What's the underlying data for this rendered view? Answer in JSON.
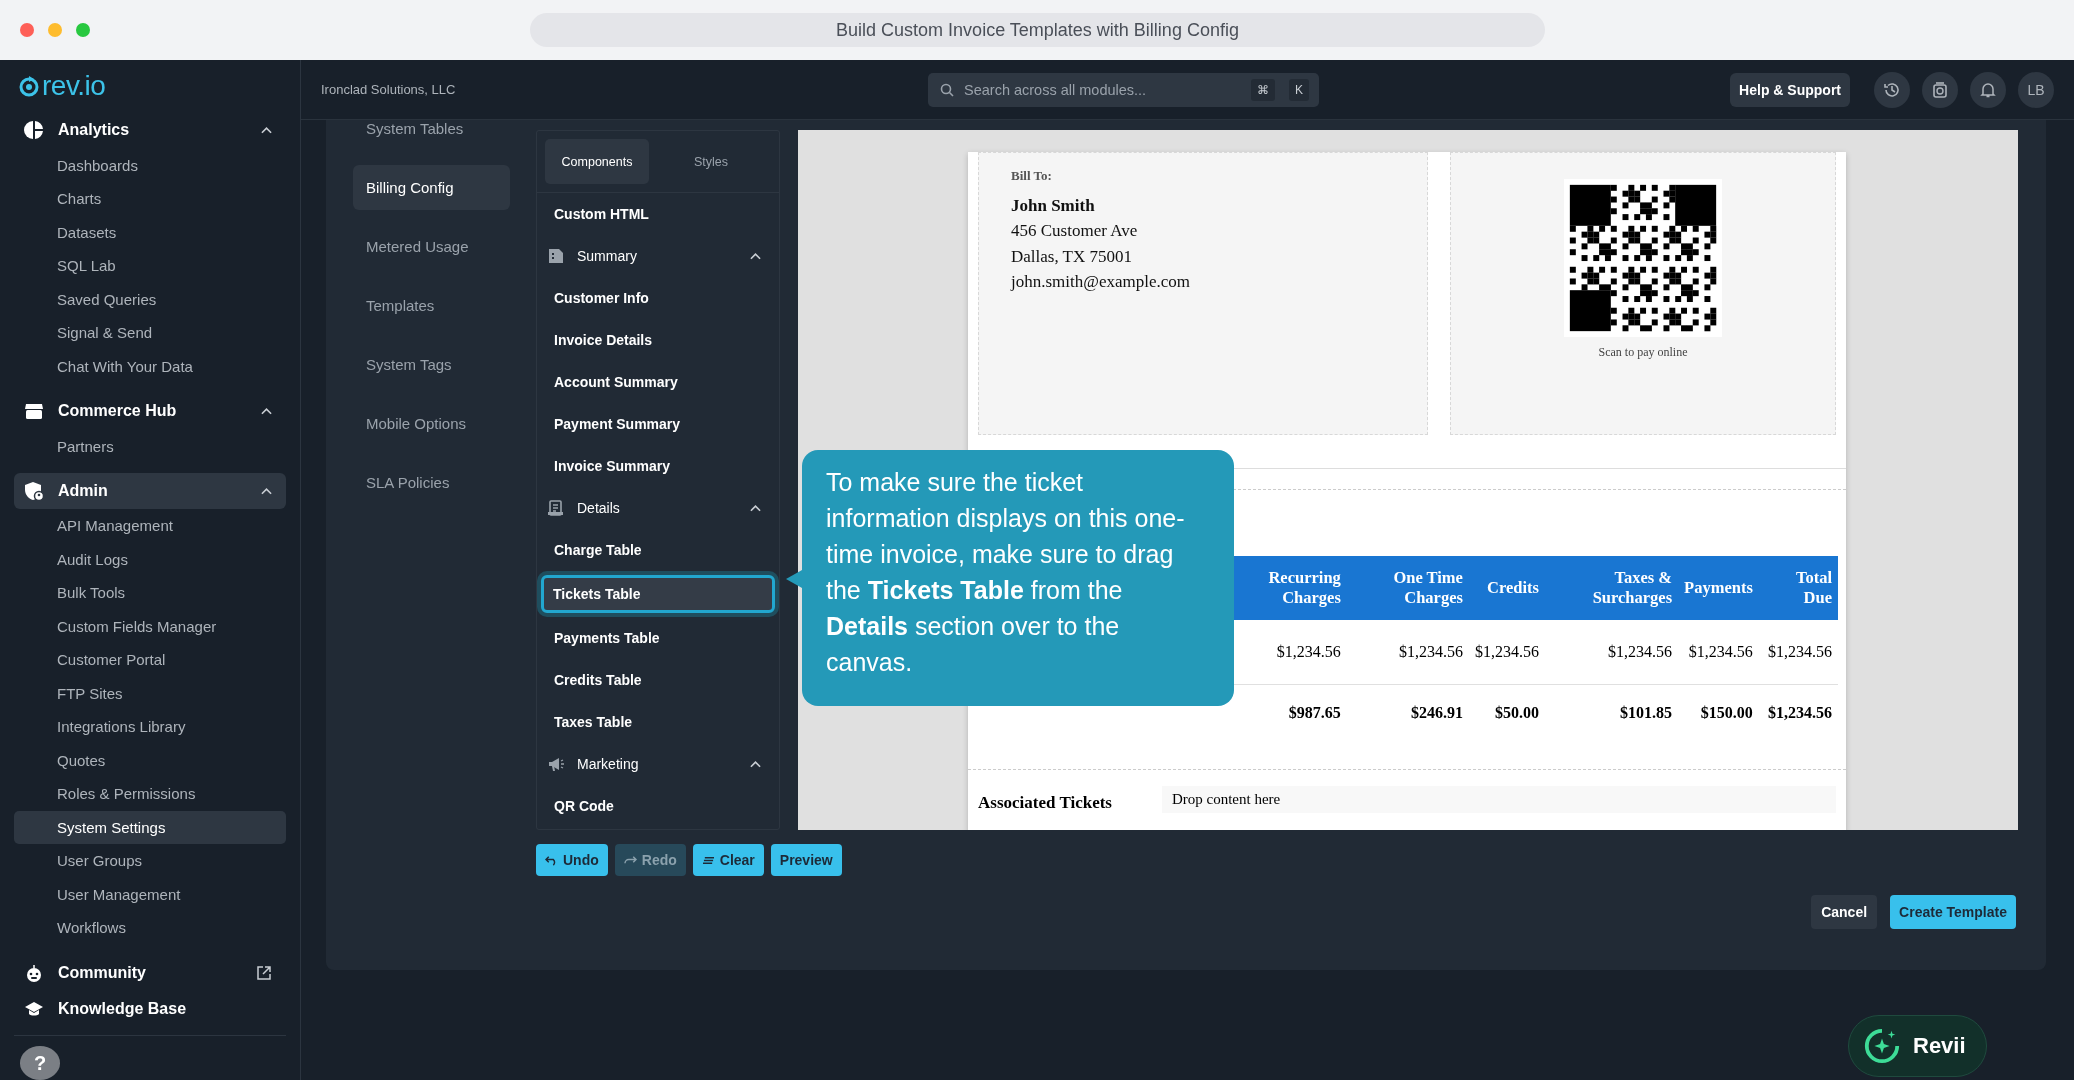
{
  "window": {
    "title": "Build Custom Invoice Templates with Billing Config"
  },
  "sidebar": {
    "logo": "rev.io",
    "groups": [
      {
        "label": "Analytics",
        "expanded": true,
        "selected": false,
        "items": [
          {
            "label": "Dashboards",
            "selected": false
          },
          {
            "label": "Charts",
            "selected": false
          },
          {
            "label": "Datasets",
            "selected": false
          },
          {
            "label": "SQL Lab",
            "selected": false
          },
          {
            "label": "Saved Queries",
            "selected": false
          },
          {
            "label": "Signal & Send",
            "selected": false
          },
          {
            "label": "Chat With Your Data",
            "selected": false
          }
        ]
      },
      {
        "label": "Commerce Hub",
        "expanded": true,
        "selected": false,
        "items": [
          {
            "label": "Partners",
            "selected": false
          }
        ]
      },
      {
        "label": "Admin",
        "expanded": true,
        "selected": true,
        "items": [
          {
            "label": "API Management",
            "selected": false
          },
          {
            "label": "Audit Logs",
            "selected": false
          },
          {
            "label": "Bulk Tools",
            "selected": false
          },
          {
            "label": "Custom Fields Manager",
            "selected": false
          },
          {
            "label": "Customer Portal",
            "selected": false
          },
          {
            "label": "FTP Sites",
            "selected": false
          },
          {
            "label": "Integrations Library",
            "selected": false
          },
          {
            "label": "Quotes",
            "selected": false
          },
          {
            "label": "Roles & Permissions",
            "selected": false
          },
          {
            "label": "System Settings",
            "selected": true
          },
          {
            "label": "User Groups",
            "selected": false
          },
          {
            "label": "User Management",
            "selected": false
          },
          {
            "label": "Workflows",
            "selected": false
          }
        ]
      }
    ],
    "links": [
      {
        "label": "Community",
        "external": true
      },
      {
        "label": "Knowledge Base",
        "external": false
      }
    ],
    "help": "?"
  },
  "header": {
    "company": "Ironclad Solutions, LLC",
    "search": {
      "placeholder": "Search across all modules...",
      "keys": [
        "⌘",
        "K"
      ]
    },
    "help_button": "Help & Support",
    "avatar": "LB"
  },
  "settings_nav": [
    {
      "label": "System Tables",
      "selected": false
    },
    {
      "label": "Billing Config",
      "selected": true
    },
    {
      "label": "Metered Usage",
      "selected": false
    },
    {
      "label": "Templates",
      "selected": false
    },
    {
      "label": "System Tags",
      "selected": false
    },
    {
      "label": "Mobile Options",
      "selected": false
    },
    {
      "label": "SLA Policies",
      "selected": false
    }
  ],
  "components_panel": {
    "tabs": [
      {
        "label": "Components",
        "selected": true
      },
      {
        "label": "Styles",
        "selected": false
      }
    ],
    "items": [
      {
        "kind": "item",
        "label": "Custom HTML",
        "selected": false
      },
      {
        "kind": "section",
        "label": "Summary",
        "expanded": true
      },
      {
        "kind": "item",
        "label": "Customer Info",
        "selected": false
      },
      {
        "kind": "item",
        "label": "Invoice Details",
        "selected": false
      },
      {
        "kind": "item",
        "label": "Account Summary",
        "selected": false
      },
      {
        "kind": "item",
        "label": "Payment Summary",
        "selected": false
      },
      {
        "kind": "item",
        "label": "Invoice Summary",
        "selected": false
      },
      {
        "kind": "section",
        "label": "Details",
        "expanded": true
      },
      {
        "kind": "item",
        "label": "Charge Table",
        "selected": false
      },
      {
        "kind": "item",
        "label": "Tickets Table",
        "selected": true
      },
      {
        "kind": "item",
        "label": "Payments Table",
        "selected": false
      },
      {
        "kind": "item",
        "label": "Credits Table",
        "selected": false
      },
      {
        "kind": "item",
        "label": "Taxes Table",
        "selected": false
      },
      {
        "kind": "section",
        "label": "Marketing",
        "expanded": true
      },
      {
        "kind": "item",
        "label": "QR Code",
        "selected": false
      }
    ]
  },
  "canvas": {
    "bill_to": {
      "label": "Bill To:",
      "name": "John Smith",
      "lines": [
        "456 Customer Ave",
        "Dallas, TX 75001",
        "john.smith@example.com"
      ]
    },
    "qr": {
      "caption": "Scan to pay online"
    },
    "table": {
      "columns": [
        "Recurring Charges",
        "One Time Charges",
        "Credits",
        "Taxes & Surcharges",
        "Payments",
        "Total Due"
      ],
      "rows": [
        {
          "kind": "data",
          "cells": [
            "$1,234.56",
            "$1,234.56",
            "$1,234.56",
            "$1,234.56",
            "$1,234.56",
            "$1,234.56"
          ]
        },
        {
          "kind": "total",
          "cells": [
            "$987.65",
            "$246.91",
            "$50.00",
            "$101.85",
            "$150.00",
            "$1,234.56"
          ]
        }
      ]
    },
    "associated": {
      "title": "Associated Tickets",
      "placeholder": "Drop content here"
    }
  },
  "tooltip": "To make sure the ticket information displays on this one-time invoice, make sure to drag the **Tickets Table** from the **Details** section over to the canvas.",
  "toolbar": [
    {
      "kind": "undo",
      "label": "Undo",
      "disabled": false
    },
    {
      "kind": "redo",
      "label": "Redo",
      "disabled": true
    },
    {
      "kind": "clear",
      "label": "Clear",
      "disabled": false
    },
    {
      "kind": "preview",
      "label": "Preview",
      "disabled": false
    }
  ],
  "actions": {
    "cancel": "Cancel",
    "create": "Create Template"
  },
  "assistant": "Revii"
}
